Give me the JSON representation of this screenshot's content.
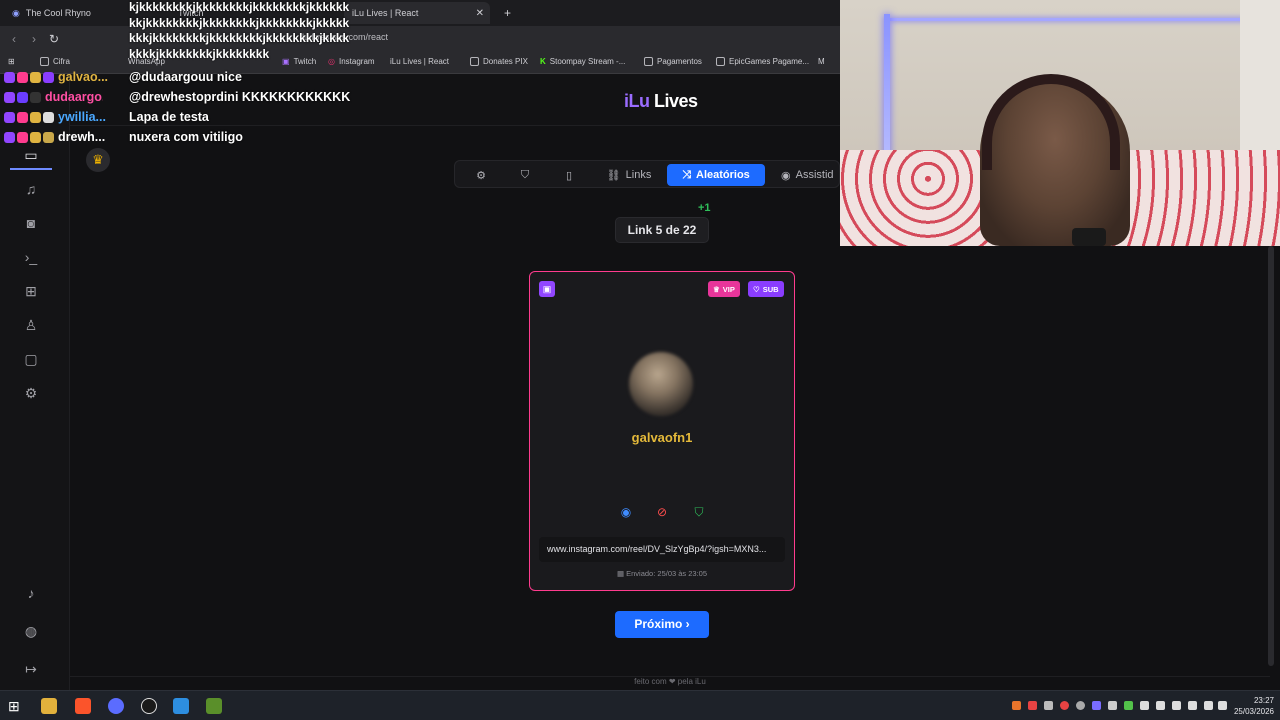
{
  "browser": {
    "tabs": [
      {
        "title": "The Cool Rhyno"
      },
      {
        "title": "Twitch"
      },
      {
        "title": "iLu Lives | React"
      }
    ],
    "url": "ilu.lives.sus.com/react",
    "bookmarks": [
      "Cifra",
      "WhatsApp",
      "Twitch",
      "Instagram",
      "iLu Lives | React",
      "Donates PIX",
      "Stoompay Stream -...",
      "Pagamentos",
      "EpicGames Pagame...",
      "M"
    ]
  },
  "app": {
    "logo_prefix": "iLu",
    "logo_suffix": " Lives"
  },
  "chat": {
    "spam_lines": [
      "kjkkkkkkkkjkkkkkkkkjkkkkkkkkjkkkkkk",
      "kkjkkkkkkkkjkkkkkkkkjkkkkkkkkjkkkkk",
      "kkkjkkkkkkkkjkkkkkkkkjkkkkkkkkjkkkk",
      "kkkkjkkkkkkkkjkkkkkkkk"
    ],
    "messages": [
      {
        "user": "galvao...",
        "user_color": "#e0b441",
        "text": "@dudaargouu nice"
      },
      {
        "user": "dudaargo...",
        "user_color": "#ff4fa3",
        "text": "@drewhestoprdini KKKKKKKKKKKK"
      },
      {
        "user": "ywillia...",
        "user_color": "#4aa8ff",
        "text": "Lapa de testa"
      },
      {
        "user": "drewh...",
        "user_color": "#ffffff",
        "text": "nuxera com vitiligo"
      }
    ]
  },
  "tabs": [
    {
      "label": "",
      "icon": "gear-icon"
    },
    {
      "label": "",
      "icon": "shield-icon"
    },
    {
      "label": "",
      "icon": "tablet-icon"
    },
    {
      "label": "Links",
      "icon": "link-icon"
    },
    {
      "label": "Aleatórios",
      "icon": "shuffle-icon",
      "active": true
    },
    {
      "label": "Assistid",
      "icon": "eye-icon"
    }
  ],
  "counter": {
    "label": "Link 5 de 22",
    "delta": "+1"
  },
  "card": {
    "platform_icon": "twitch-icon",
    "badges": {
      "vip": "VIP",
      "sub": "SUB"
    },
    "username": "galvaofn1",
    "link": "www.instagram.com/reel/DV_SlzYgBp4/?igsh=MXN3...",
    "sent": "Enviado: 25/03 às 23:05"
  },
  "next_button": "Próximo ›",
  "footer": "feito com ❤ pela iLu",
  "taskbar": {
    "time": "23:27",
    "date": "25/03/2026"
  },
  "colors": {
    "accent": "#1d6bff",
    "card_border": "#ff3c8e",
    "username": "#e4b93a",
    "logo_purple": "#9a6cff"
  }
}
